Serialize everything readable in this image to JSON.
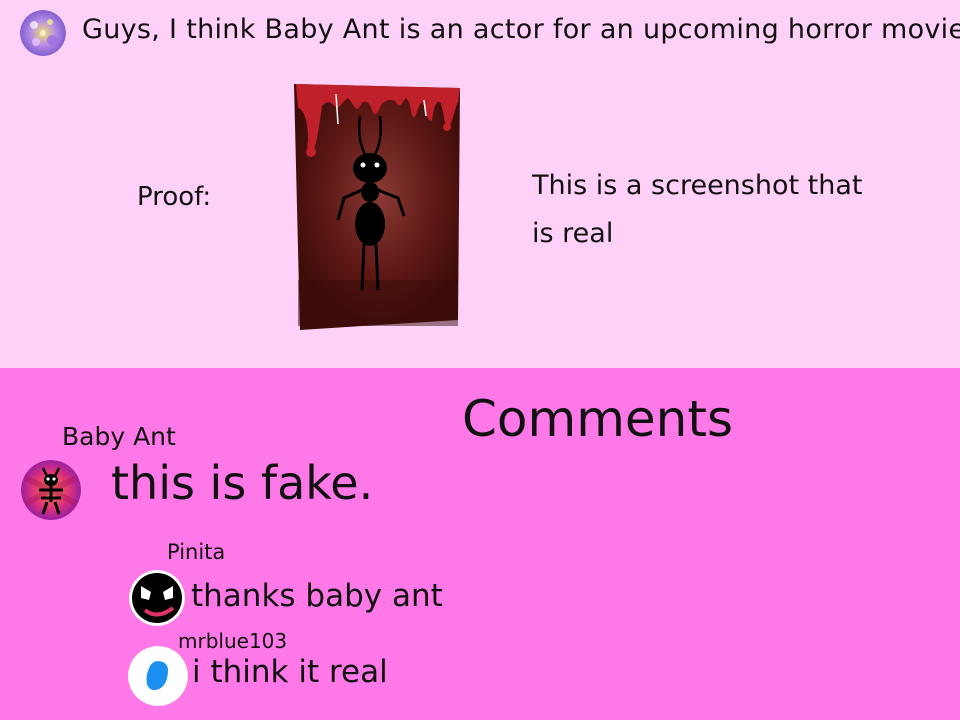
{
  "post": {
    "title": "Guys, I think Baby Ant is an actor for an upcoming horror movie",
    "proof_label": "Proof:",
    "caption": "This is a screenshot that is real",
    "avatar_icon": "galaxy-avatar-icon",
    "image_icon": "horror-ant-poster-image"
  },
  "comments": {
    "title": "Comments",
    "items": [
      {
        "user": "Baby Ant",
        "text": "this is fake.",
        "avatar_icon": "ant-avatar-icon"
      },
      {
        "user": "Pinita",
        "text": "thanks baby ant",
        "avatar_icon": "angry-face-avatar-icon"
      },
      {
        "user": "mrblue103",
        "text": "i think it real",
        "avatar_icon": "blue-blob-avatar-icon"
      }
    ]
  },
  "colors": {
    "post_background": "#ffd0f8",
    "comments_background": "#ff78e8",
    "poster_dark_red": "#5a1612",
    "blood_red": "#c0202a"
  }
}
